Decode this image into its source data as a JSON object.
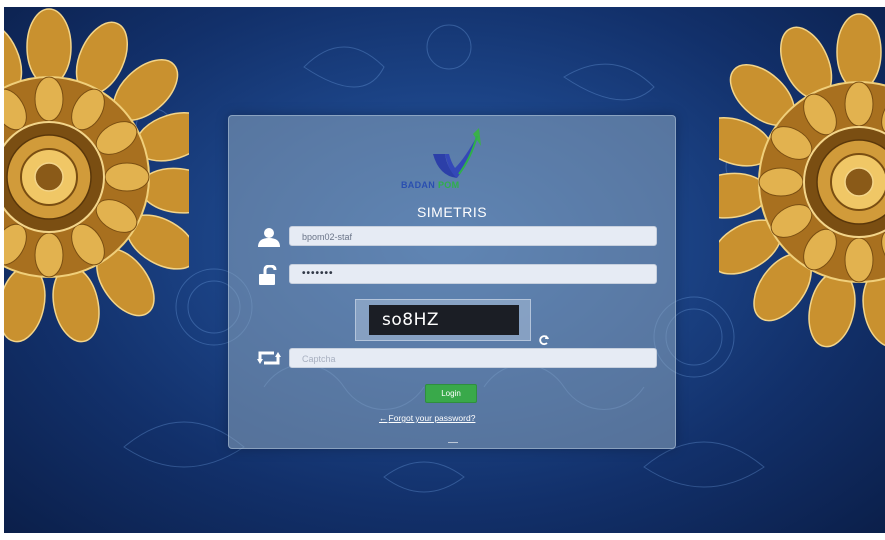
{
  "branding": {
    "logo_text_main": "BADAN",
    "logo_text_accent": "POM",
    "app_title": "SIMETRIS",
    "logo_icon": "checkmark-swoosh-logo"
  },
  "login_form": {
    "username_icon": "user-icon",
    "username_value": "bpom02-staf",
    "password_icon": "unlock-icon",
    "password_value": "•••••••",
    "captcha_text": "so8HZ",
    "refresh_icon": "refresh-icon",
    "captcha_input_icon": "retweet-icon",
    "captcha_placeholder": "Captcha",
    "login_label": "Login",
    "forgot_label": "Forgot your password?"
  },
  "colors": {
    "background": "#1c4487",
    "login_button": "#39a94a",
    "mandala_gold": "#d9a544"
  }
}
